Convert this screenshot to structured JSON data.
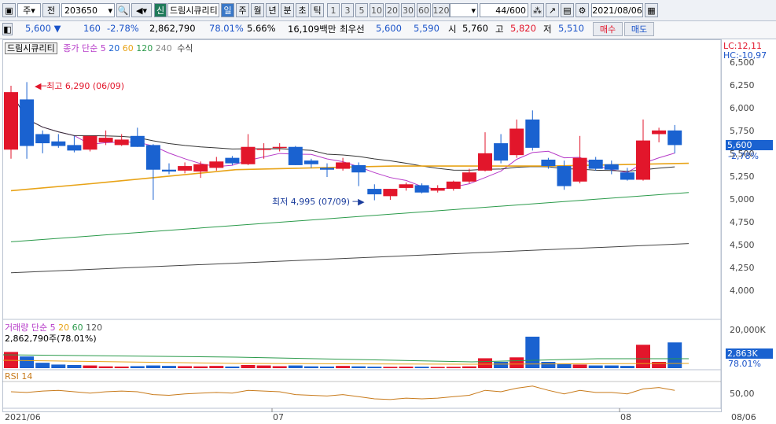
{
  "toolbar": {
    "market_type": "주",
    "prev_label": "전",
    "stock_code": "203650",
    "credit_tag": "신",
    "stock_name": "드림시큐리티",
    "period_tabs": [
      "일",
      "주",
      "월",
      "년",
      "분",
      "초",
      "틱"
    ],
    "selected_period": "일",
    "interval_buttons": [
      "1",
      "3",
      "5",
      "10",
      "20",
      "30",
      "60",
      "120"
    ],
    "count_display": "44",
    "count_total": "/600",
    "date": "2021/08/06"
  },
  "quote": {
    "price": "5,600",
    "change": "160",
    "change_pct": "-2.78%",
    "volume": "2,862,790",
    "volume_ratio": "78.01%",
    "turnover": "5.66%",
    "amount": "16,109백만",
    "best_label": "최우선",
    "best_ask": "5,600",
    "best_bid": "5,590",
    "open_label": "시",
    "open": "5,760",
    "high_label": "고",
    "high": "5,820",
    "low_label": "저",
    "low": "5,510",
    "buy_label": "매수",
    "sell_label": "매도"
  },
  "legend": {
    "name": "드림시큐리티",
    "ma_label": "종가 단순 5",
    "ma_periods": [
      "20",
      "60",
      "120",
      "240"
    ],
    "formula": "수식",
    "lc": "LC:12,11",
    "hc": "HC:-10,97"
  },
  "annotations": {
    "high": "최고 6,290 (06/09)",
    "low": "최저 4,995 (07/09)"
  },
  "price_axis": {
    "labels": [
      "6,500",
      "6,250",
      "6,000",
      "5,750",
      "5,500",
      "5,250",
      "5,000",
      "4,750",
      "4,500",
      "4,250",
      "4,000"
    ],
    "current_price": "5,600",
    "current_pct": "-2,78%"
  },
  "volume_panel": {
    "label": "거래량 단순 5",
    "ma_periods": [
      "20",
      "60",
      "120"
    ],
    "current": "2,862,790주(78.01%)",
    "axis_label": "20,000K",
    "current_axis": "2,863K",
    "current_pct": "78.01%"
  },
  "rsi_panel": {
    "label": "RSI 14",
    "axis_label": "50,00"
  },
  "date_axis": {
    "labels": [
      "2021/06",
      "07",
      "08"
    ],
    "right_label": "08/06"
  },
  "colors": {
    "up": "#e2162b",
    "down": "#1a62d0",
    "ma5": "#b63ac8",
    "ma20": "#e8a317",
    "ma60": "#2a9a4a",
    "ma120": "#333333"
  },
  "chart_data": {
    "type": "candlestick",
    "categories_note": "daily candles 2021/06 – 2021/08/06",
    "candles": [
      {
        "o": 5550,
        "h": 6250,
        "l": 5450,
        "c": 6180
      },
      {
        "o": 6100,
        "h": 6290,
        "l": 5450,
        "c": 5590
      },
      {
        "o": 5720,
        "h": 5760,
        "l": 5510,
        "c": 5620
      },
      {
        "o": 5640,
        "h": 5720,
        "l": 5570,
        "c": 5590
      },
      {
        "o": 5600,
        "h": 5700,
        "l": 5520,
        "c": 5540
      },
      {
        "o": 5550,
        "h": 5700,
        "l": 5530,
        "c": 5700
      },
      {
        "o": 5630,
        "h": 5760,
        "l": 5600,
        "c": 5680
      },
      {
        "o": 5600,
        "h": 5720,
        "l": 5590,
        "c": 5660
      },
      {
        "o": 5700,
        "h": 5790,
        "l": 5580,
        "c": 5580
      },
      {
        "o": 5600,
        "h": 5610,
        "l": 5000,
        "c": 5330
      },
      {
        "o": 5330,
        "h": 5400,
        "l": 5280,
        "c": 5310
      },
      {
        "o": 5320,
        "h": 5410,
        "l": 5290,
        "c": 5370
      },
      {
        "o": 5310,
        "h": 5420,
        "l": 5240,
        "c": 5390
      },
      {
        "o": 5350,
        "h": 5470,
        "l": 5320,
        "c": 5420
      },
      {
        "o": 5460,
        "h": 5480,
        "l": 5380,
        "c": 5400
      },
      {
        "o": 5390,
        "h": 5720,
        "l": 5380,
        "c": 5580
      },
      {
        "o": 5560,
        "h": 5620,
        "l": 5450,
        "c": 5560
      },
      {
        "o": 5570,
        "h": 5620,
        "l": 5530,
        "c": 5580
      },
      {
        "o": 5580,
        "h": 5590,
        "l": 5380,
        "c": 5380
      },
      {
        "o": 5430,
        "h": 5450,
        "l": 5350,
        "c": 5390
      },
      {
        "o": 5350,
        "h": 5400,
        "l": 5250,
        "c": 5330
      },
      {
        "o": 5340,
        "h": 5460,
        "l": 5320,
        "c": 5410
      },
      {
        "o": 5380,
        "h": 5410,
        "l": 5150,
        "c": 5300
      },
      {
        "o": 5120,
        "h": 5170,
        "l": 4995,
        "c": 5060
      },
      {
        "o": 5040,
        "h": 5120,
        "l": 5000,
        "c": 5120
      },
      {
        "o": 5130,
        "h": 5190,
        "l": 5100,
        "c": 5170
      },
      {
        "o": 5160,
        "h": 5180,
        "l": 5070,
        "c": 5080
      },
      {
        "o": 5100,
        "h": 5160,
        "l": 5080,
        "c": 5130
      },
      {
        "o": 5120,
        "h": 5210,
        "l": 5100,
        "c": 5200
      },
      {
        "o": 5200,
        "h": 5340,
        "l": 5180,
        "c": 5300
      },
      {
        "o": 5320,
        "h": 5740,
        "l": 5310,
        "c": 5510
      },
      {
        "o": 5620,
        "h": 5720,
        "l": 5400,
        "c": 5430
      },
      {
        "o": 5490,
        "h": 5880,
        "l": 5460,
        "c": 5780
      },
      {
        "o": 5880,
        "h": 5980,
        "l": 5540,
        "c": 5570
      },
      {
        "o": 5440,
        "h": 5460,
        "l": 5340,
        "c": 5370
      },
      {
        "o": 5370,
        "h": 5430,
        "l": 5110,
        "c": 5150
      },
      {
        "o": 5200,
        "h": 5700,
        "l": 5180,
        "c": 5460
      },
      {
        "o": 5440,
        "h": 5470,
        "l": 5320,
        "c": 5340
      },
      {
        "o": 5390,
        "h": 5430,
        "l": 5280,
        "c": 5330
      },
      {
        "o": 5300,
        "h": 5350,
        "l": 5210,
        "c": 5220
      },
      {
        "o": 5220,
        "h": 5880,
        "l": 5210,
        "c": 5650
      },
      {
        "o": 5720,
        "h": 5790,
        "l": 5630,
        "c": 5760
      },
      {
        "o": 5760,
        "h": 5820,
        "l": 5510,
        "c": 5600
      }
    ],
    "volume": [
      1800,
      1300,
      600,
      400,
      350,
      300,
      200,
      180,
      220,
      300,
      250,
      220,
      200,
      250,
      180,
      350,
      300,
      220,
      300,
      200,
      180,
      250,
      200,
      160,
      150,
      170,
      160,
      140,
      150,
      200,
      1100,
      700,
      1200,
      3500,
      700,
      500,
      400,
      300,
      300,
      250,
      2600,
      700,
      2863
    ],
    "ylim": [
      3800,
      6500
    ],
    "volume_max_label": "20,000K"
  }
}
